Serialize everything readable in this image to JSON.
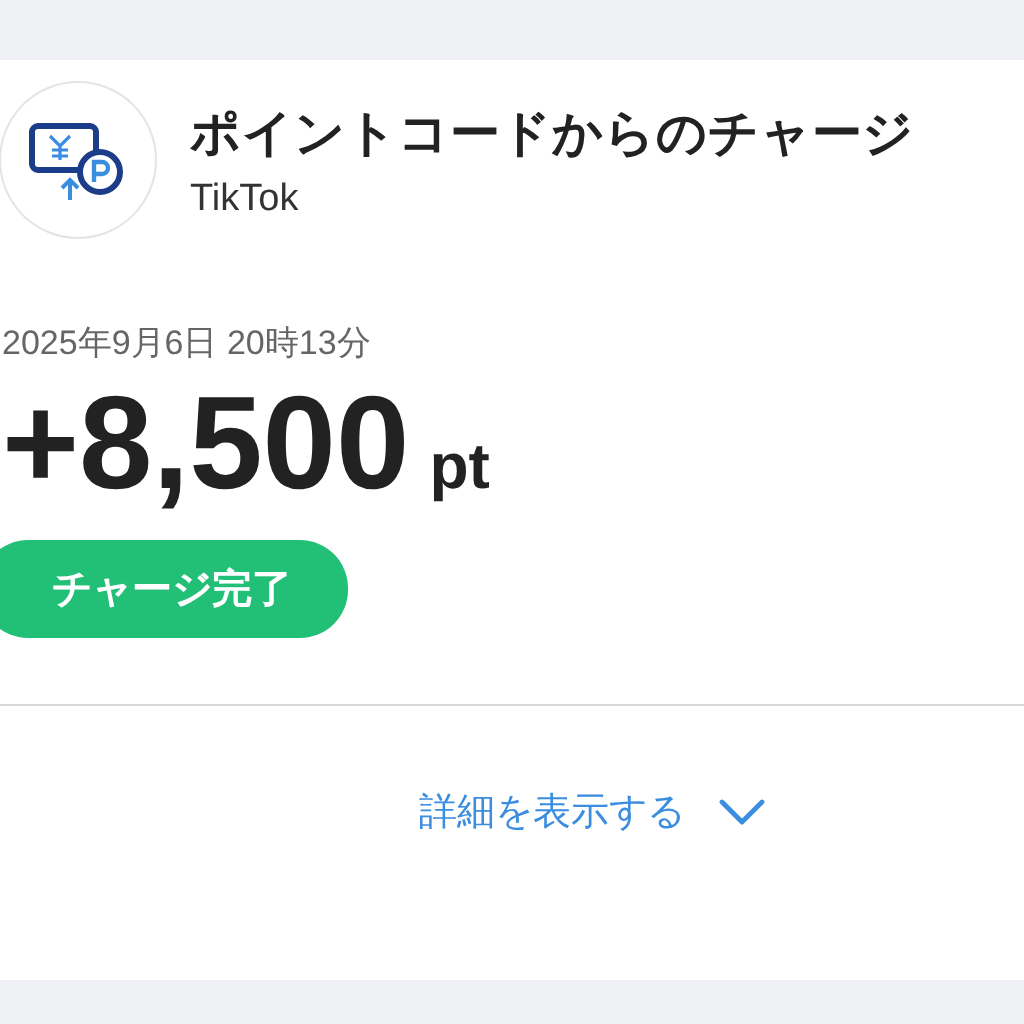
{
  "transaction": {
    "title": "ポイントコードからのチャージ",
    "merchant": "TikTok",
    "datetime": "2025年9月6日 20時13分",
    "amount": "+8,500",
    "unit": "pt",
    "status": "チャージ完了"
  },
  "details_toggle": {
    "label": "詳細を表示する",
    "expanded": false
  }
}
